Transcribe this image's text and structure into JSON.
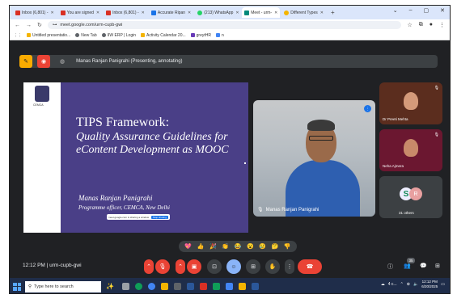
{
  "browser": {
    "tabs": [
      {
        "label": "Inbox (6,801) - ",
        "color": "#d93025"
      },
      {
        "label": "You are signed",
        "color": "#d93025"
      },
      {
        "label": "Inbox (6,801) - ",
        "color": "#d93025"
      },
      {
        "label": "Accurate Ripan",
        "color": "#1a73e8"
      },
      {
        "label": "(213) WhatsApp",
        "color": "#25d366"
      },
      {
        "label": "Meet - urm-",
        "color": "#00897b",
        "active": true
      },
      {
        "label": "Different Types",
        "color": "#f4b400"
      }
    ],
    "new_tab": "+",
    "window_controls": [
      "⌄",
      "–",
      "▢",
      "✕"
    ],
    "url": "meet.google.com/urm-cupb-gwi",
    "bookmarks": [
      {
        "label": "Untitled presentatio...",
        "color": "#f4b400"
      },
      {
        "label": "New Tab",
        "color": "#5f6368"
      },
      {
        "label": "IIW ERP | Login",
        "color": "#5f6368"
      },
      {
        "label": "Activity Calendar 20...",
        "color": "#f4b400"
      },
      {
        "label": "greytHR",
        "color": "#673ab7"
      },
      {
        "label": "n",
        "color": "#4285f4"
      }
    ]
  },
  "meet": {
    "presenting_text": "Manas Ranjan Panigrahi (Presenting, annotating)",
    "slide": {
      "logo_text": "CEMCA",
      "title": "TIPS Framework:",
      "subtitle": "Quality Assurance Guidelines for eContent Development as MOOC",
      "presenter": "Manas Ranjan Panigrahi",
      "org": "Programme officer, CEMCA, New Delhi",
      "share_notice": "meet.google.com is sharing a window",
      "stop_label": "Stop sharing"
    },
    "main_video_name": "Manas Ranjan Panigrahi",
    "participants": [
      {
        "name": "Dr Preeti Mehta"
      },
      {
        "name": "Neha Ajmera"
      },
      {
        "name": "31 others",
        "avatar_a": "S",
        "avatar_b": "R"
      }
    ],
    "reactions": [
      "💖",
      "👍",
      "🎉",
      "👏",
      "😂",
      "😮",
      "😢",
      "🤔",
      "👎"
    ],
    "clock": "12:12 PM",
    "meeting_code": "urm-cupb-gwi",
    "participant_count_badge": "35"
  },
  "taskbar": {
    "search_placeholder": "Type here to search",
    "weather": "4 c...",
    "time": "12:12 PM",
    "date": "6/20/2025"
  },
  "colors": {
    "meet_bg": "#202124",
    "control_bg": "#3c4043",
    "end_call": "#ea4335",
    "slide_bg": "#4a3f87"
  }
}
